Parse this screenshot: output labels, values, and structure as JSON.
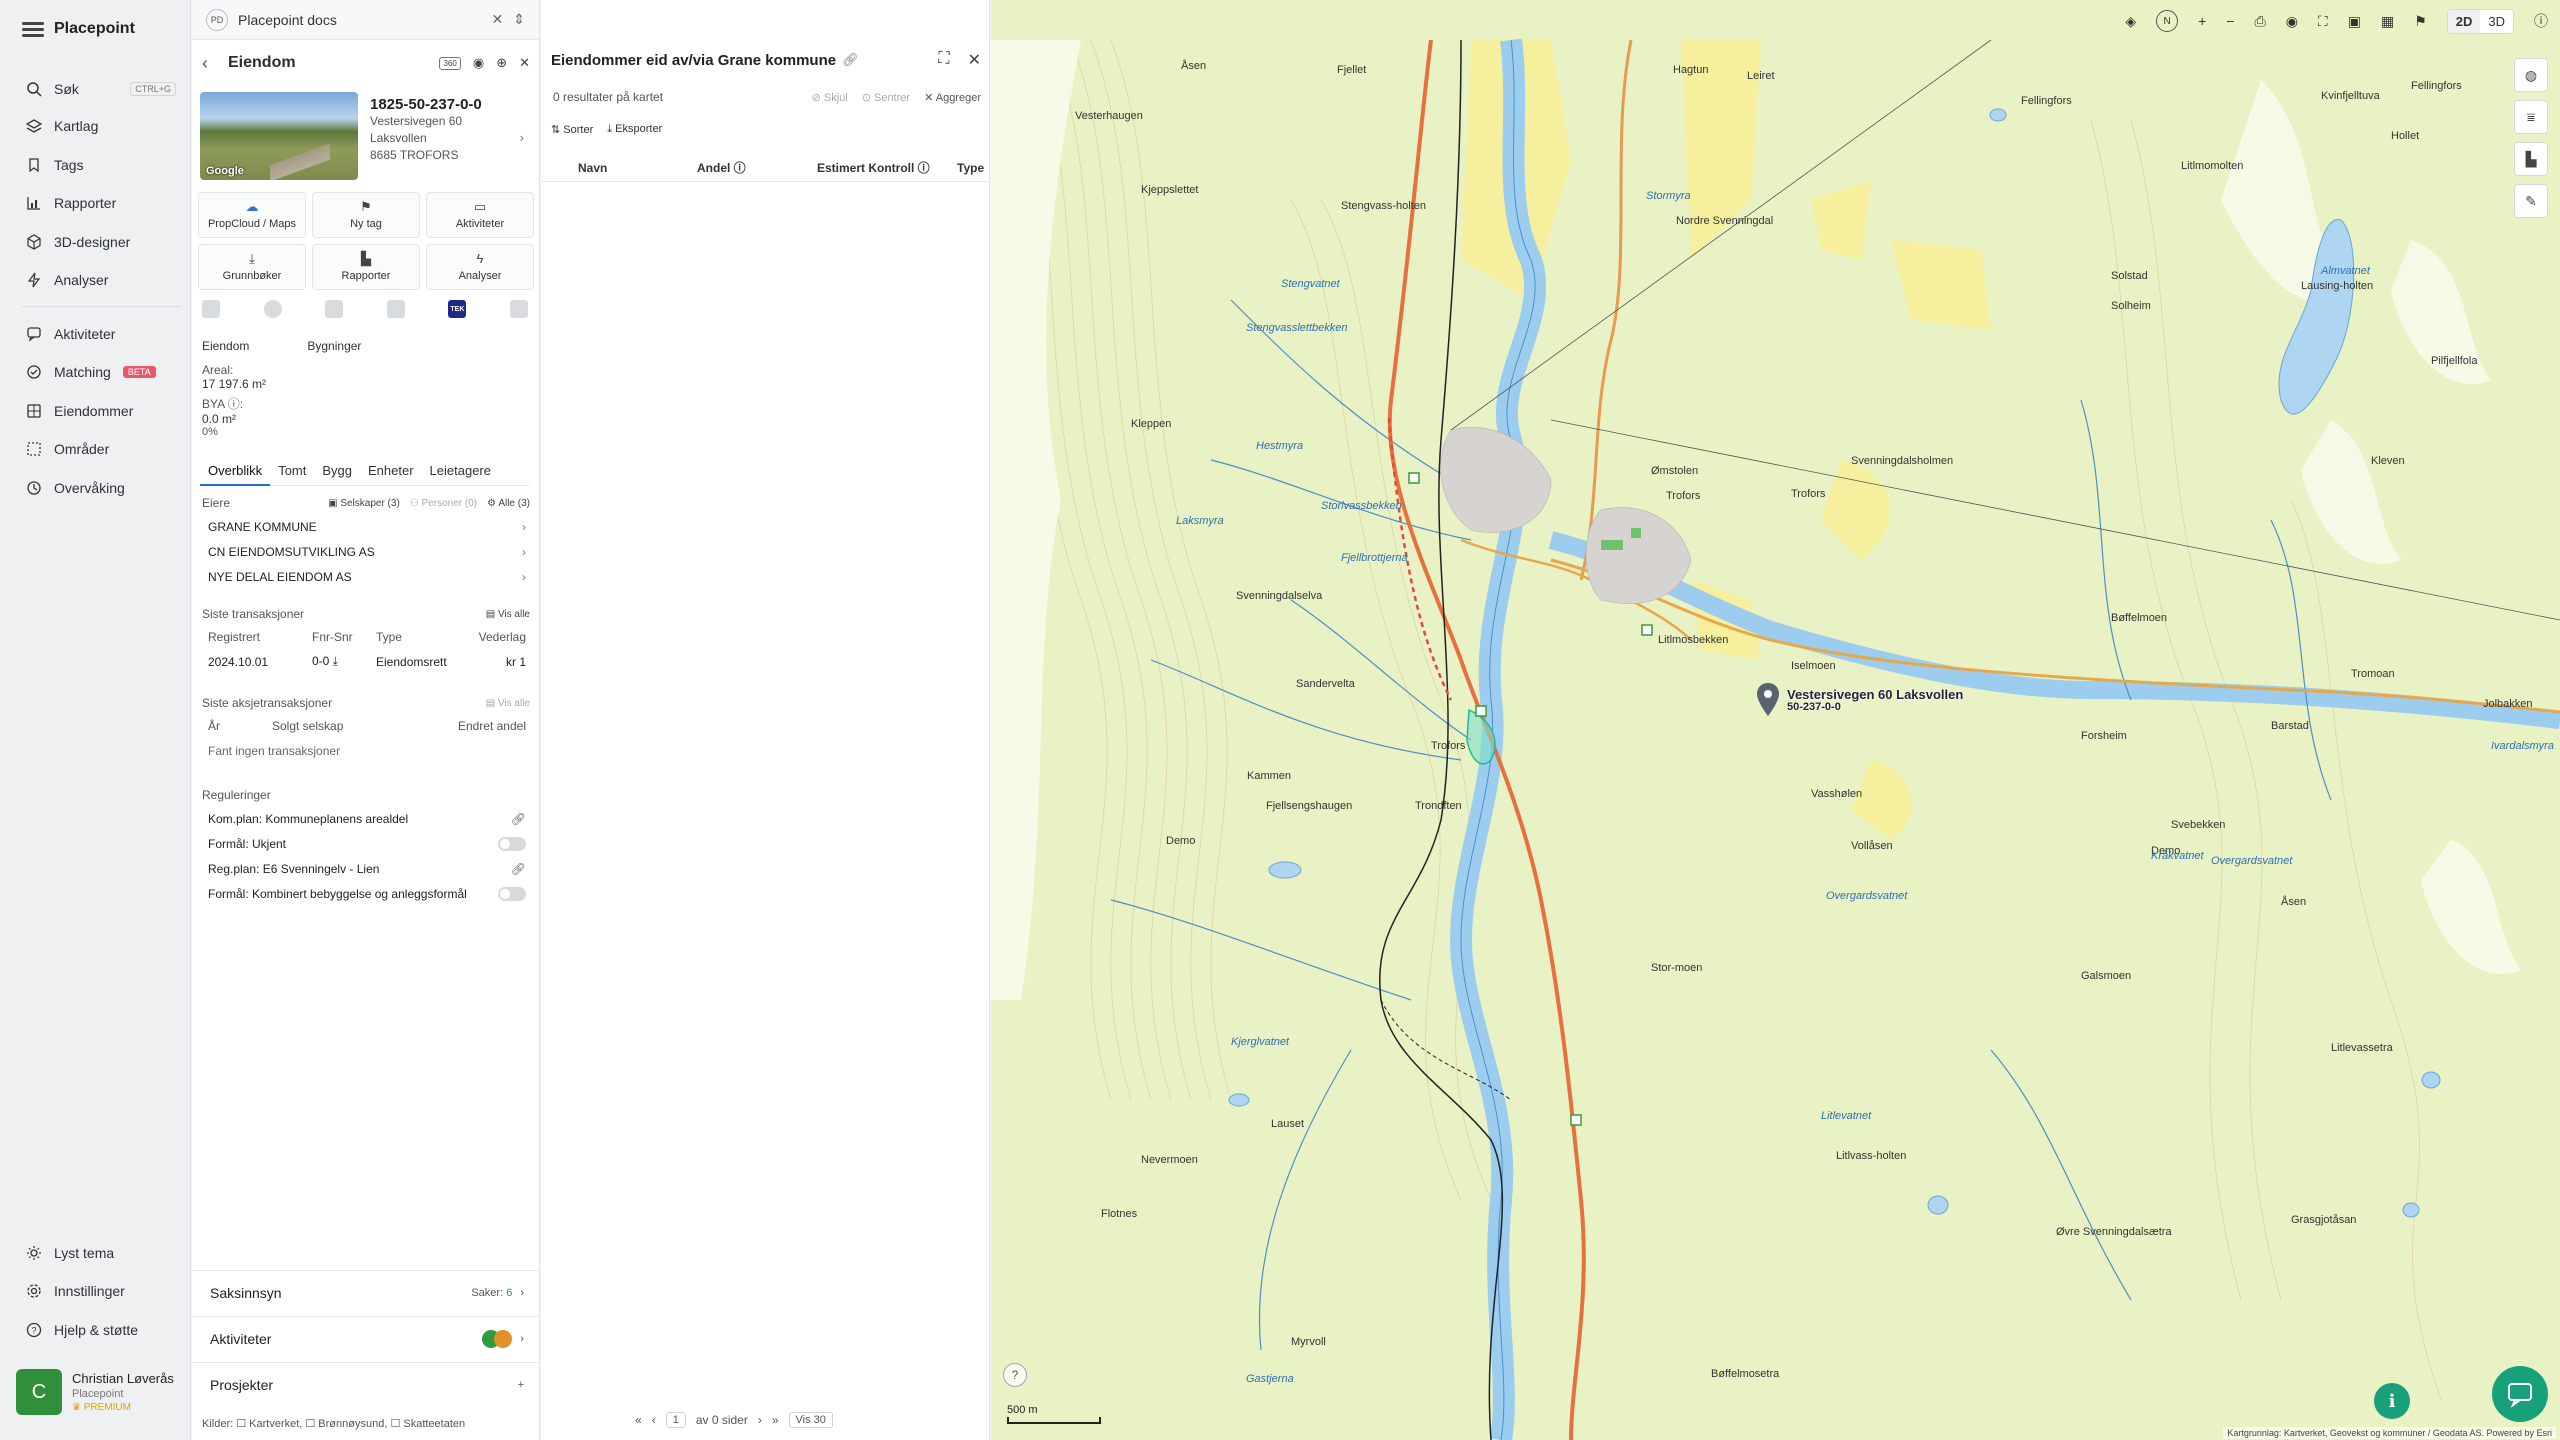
{
  "nav": {
    "brand": "Placepoint",
    "items": [
      {
        "label": "Søk",
        "kbd": "CTRL+G",
        "icon": "search-icon"
      },
      {
        "label": "Kartlag",
        "icon": "layers-icon"
      },
      {
        "label": "Tags",
        "icon": "bookmark-icon"
      },
      {
        "label": "Rapporter",
        "icon": "chart-icon"
      },
      {
        "label": "3D-designer",
        "icon": "cube-icon"
      },
      {
        "label": "Analyser",
        "icon": "bolt-icon"
      },
      {
        "label": "Aktiviteter",
        "icon": "message-icon"
      },
      {
        "label": "Matching",
        "badge": "BETA",
        "icon": "match-icon"
      },
      {
        "label": "Eiendommer",
        "icon": "building-icon"
      },
      {
        "label": "Områder",
        "icon": "area-icon"
      },
      {
        "label": "Overvåking",
        "icon": "monitor-icon"
      }
    ],
    "bottom": [
      {
        "label": "Lyst tema",
        "icon": "sun-icon"
      },
      {
        "label": "Innstillinger",
        "icon": "gear-icon"
      },
      {
        "label": "Hjelp & støtte",
        "icon": "help-icon"
      }
    ],
    "user": {
      "initial": "C",
      "name": "Christian Løverås",
      "company": "Placepoint",
      "plan": "PREMIUM",
      "color": "#2f8f3a"
    }
  },
  "panel1": {
    "topbar_badge": "PD",
    "topbar_title": "Placepoint docs",
    "title": "Eiendom",
    "badge_360": "360",
    "property": {
      "gnr": "1825-50-237-0-0",
      "address": "Vestersivegen 60",
      "place": "Laksvollen",
      "postal": "8685 TROFORS",
      "image_label": "Google"
    },
    "tiles": [
      "PropCloud / Maps",
      "Ny tag",
      "Aktiviteter",
      "Grunnbøker",
      "Rapporter",
      "Analyser"
    ],
    "source_tek": "TEK",
    "subtabs": [
      "Eiendom",
      "Bygninger"
    ],
    "areal_label": "Areal:",
    "areal_value": "17 197.6 m²",
    "bya_label": "BYA ⓘ:",
    "bya_value": "0.0 m²",
    "bya_pct": "0%",
    "tabs": [
      "Overblikk",
      "Tomt",
      "Bygg",
      "Enheter",
      "Leietagere"
    ],
    "owners": {
      "label": "Eiere",
      "filters": [
        "Selskaper (3)",
        "Personer (0)",
        "Alle (3)"
      ],
      "list": [
        "GRANE KOMMUNE",
        "CN EIENDOMSUTVIKLING AS",
        "NYE DELAL EIENDOM AS"
      ]
    },
    "transactions": {
      "label": "Siste transaksjoner",
      "action": "Vis alle",
      "cols": [
        "Registrert",
        "Fnr-Snr",
        "Type",
        "Vederlag"
      ],
      "row": [
        "2024.10.01",
        "0-0 ⤓",
        "Eiendomsrett",
        "kr 1"
      ]
    },
    "share_tx": {
      "label": "Siste aksjetransaksjoner",
      "action": "Vis alle",
      "cols": [
        "År",
        "Solgt selskap",
        "Endret andel"
      ],
      "empty": "Fant ingen transaksjoner"
    },
    "regulations": {
      "label": "Reguleringer",
      "items": [
        "Kom.plan: Kommuneplanens arealdel",
        "Formål: Ukjent",
        "Reg.plan: E6 Svenningelv - Lien",
        "Formål: Kombinert bebyggelse og anleggsformål"
      ]
    },
    "accordions": {
      "saksinnsyn": "Saksinnsyn",
      "saker_label": "Saker:",
      "saker_count": "6",
      "aktiviteter": "Aktiviteter",
      "prosjekter": "Prosjekter"
    },
    "kilder": "Kilder: ☐ Kartverket, ☐ Brønnøysund, ☐ Skatteetaten"
  },
  "panel2": {
    "title": "Eiendommer eid av/via Grane kommune",
    "results": "0 resultater på kartet",
    "skjul": "Skjul",
    "sentrer": "Sentrer",
    "aggreger": "Aggreger",
    "sorter": "Sorter",
    "eksporter": "Eksporter",
    "columns": [
      "Navn",
      "Andel ⓘ",
      "Estimert Kontroll ⓘ",
      "Type"
    ],
    "pager": {
      "page": "1",
      "of": "av 0 sider",
      "per_page": "Vis 30"
    }
  },
  "map": {
    "mode_2d": "2D",
    "mode_3d": "3D",
    "compass": "N",
    "marker_label_1": "Vestersivegen 60 Laksvollen",
    "marker_label_2": "50-237-0-0",
    "scale": "500 m",
    "attribution": "Kartgrunnlag: Kartverket, Geovekst og kommuner / Geodata AS. Powered by Esri",
    "help": "?",
    "labels": [
      "Åsen",
      "Fjellet",
      "Hagtun",
      "Leiret",
      "Vesterhaugen",
      "Kvinfjelltuva",
      "Fellingfors",
      "Hollet",
      "Kjeppslettet",
      "Stengvass-holten",
      "Nordre Svenningdal",
      "Stormyra",
      "Fellingfors",
      "Litlmomolten",
      "Solstad",
      "Solheim",
      "Lausing-holten",
      "Almvatnet",
      "Pilfjellfola",
      "Stengvasslettbekken",
      "Stengvatnet",
      "Kleppen",
      "Hestmyra",
      "Storlvassbekken",
      "Trofors",
      "Trofors",
      "Svenningdalsholmen",
      "Kleven",
      "Laksmyra",
      "Fjellbrottjerna",
      "Ømstolen",
      "Svenningdalselva",
      "Litlmosbekken",
      "Iselmoen",
      "Bøffelmoen",
      "Tromoan",
      "Jolbakken",
      "Barstad",
      "Ivardalsmyra",
      "Sandervelta",
      "Trofors",
      "Vasshølen",
      "Forsheim",
      "Trondften",
      "Vollåsen",
      "Svebekken",
      "Demo",
      "Demo",
      "Fjellsengshaugen",
      "Overgardsvatnet",
      "Kråkvatnet",
      "Åsen",
      "Kammen",
      "Overgardsvatnet",
      "Stor-moen",
      "Galsmoen",
      "Kjerglvatnet",
      "Litlevassetra",
      "Lauset",
      "Litlevatnet",
      "Nevermoen",
      "Litlvass-holten",
      "Flotnes",
      "Øvre Svenningdalsætra",
      "Grasgjotåsan",
      "Bøffelmosetra",
      "Myrvoll",
      "Gastjerna"
    ],
    "water_labels": [
      "Almvatnet",
      "Stormyra",
      "Stengvatnet",
      "Hestmyra",
      "Laksmyra",
      "Fjellbrottjerna",
      "Ivardalsmyra",
      "Overgardsvatnet",
      "Kråkvatnet",
      "Litlevatnet",
      "Gastjerna",
      "Stengvasslettbekken",
      "Storlvassbekken",
      "Kjerglvatnet"
    ]
  }
}
